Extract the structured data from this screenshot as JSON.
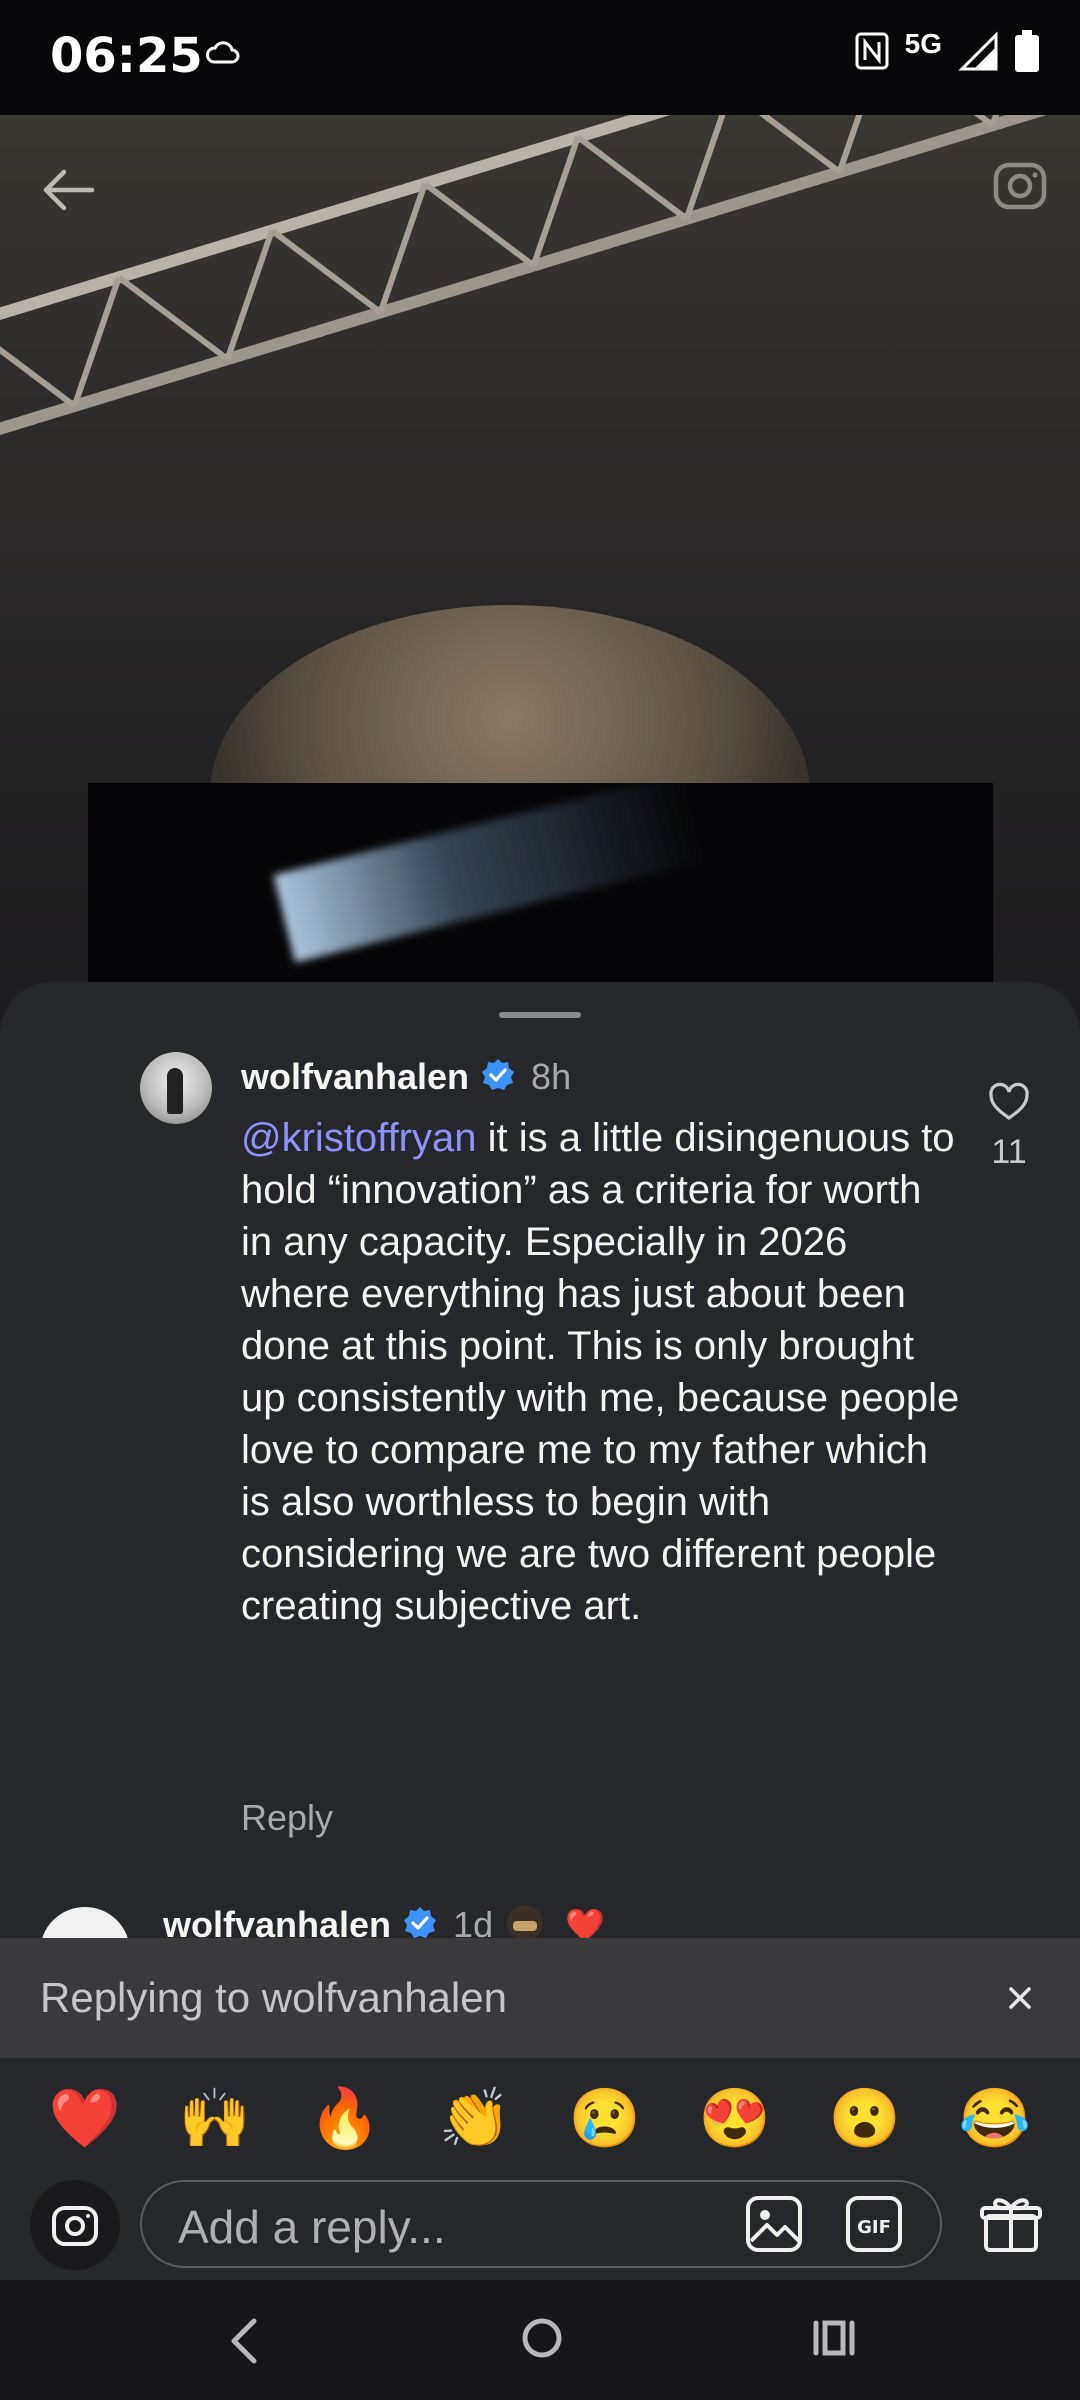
{
  "status_bar": {
    "time": "06:25",
    "network": "5G",
    "icons": [
      "cloud-icon",
      "nfc-icon",
      "signal-icon",
      "battery-icon"
    ]
  },
  "media": {
    "icons": [
      "back-arrow-icon",
      "camera-icon"
    ]
  },
  "comment": {
    "username": "wolfvanhalen",
    "verified": true,
    "time": "8h",
    "mention": "@kristoffryan",
    "text": " it is a little disingenuous to hold “innovation” as a criteria for worth in any capacity. Especially in 2026 where everything has just about been done at this point. This is only brought up consistently with me, because people love to compare me to my father which is also worthless to begin with considering we are two different people creating subjective art.",
    "reply_label": "Reply",
    "like_count": "11"
  },
  "next_comment": {
    "username": "wolfvanhalen",
    "verified": true,
    "time": "1d",
    "badge_emoji": "❤️"
  },
  "replying_banner": {
    "text": "Replying to wolfvanhalen"
  },
  "emoji_bar": [
    "❤️",
    "🙌",
    "🔥",
    "👏",
    "😢",
    "😍",
    "😮",
    "😂"
  ],
  "reply_input": {
    "placeholder": "Add a reply...",
    "gif_label": "GIF"
  },
  "colors": {
    "mention": "#8c93ff",
    "verified": "#3d92f5",
    "sheet": "#26272b"
  }
}
